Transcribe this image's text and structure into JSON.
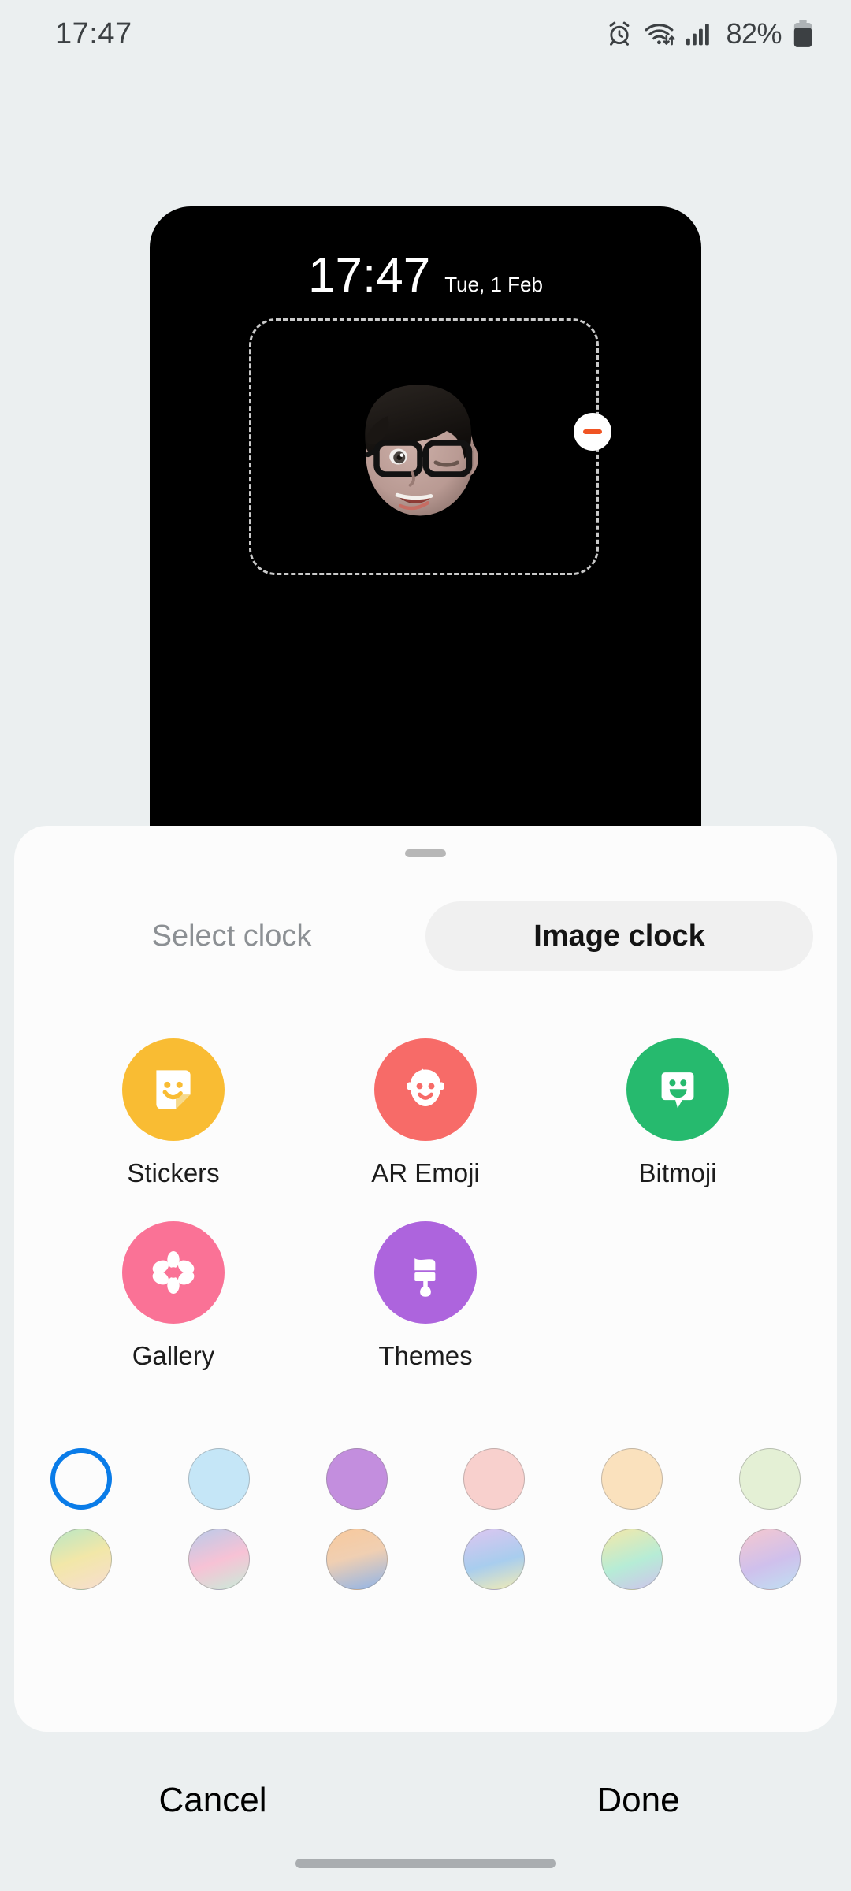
{
  "status_bar": {
    "clock": "17:47",
    "battery_percent": "82%",
    "icons": [
      "alarm-icon",
      "wifi-icon",
      "signal-icon",
      "battery-icon"
    ]
  },
  "preview": {
    "time": "17:47",
    "date": "Tue, 1 Feb",
    "remove_badge": "remove-icon",
    "avatar": "ar-emoji-avatar"
  },
  "sheet": {
    "tabs": [
      {
        "label": "Select clock",
        "active": false
      },
      {
        "label": "Image clock",
        "active": true
      }
    ],
    "apps": [
      {
        "label": "Stickers",
        "icon": "stickers-icon",
        "color": "#f9bc33"
      },
      {
        "label": "AR Emoji",
        "icon": "ar-emoji-icon",
        "color": "#f76b68"
      },
      {
        "label": "Bitmoji",
        "icon": "bitmoji-icon",
        "color": "#26ba6e"
      },
      {
        "label": "Gallery",
        "icon": "gallery-icon",
        "color": "#fa7296"
      },
      {
        "label": "Themes",
        "icon": "themes-icon",
        "color": "#ad64dd"
      }
    ],
    "swatch_rows": [
      [
        {
          "name": "white",
          "fill": "#fcfcfc",
          "selected": true
        },
        {
          "name": "light-blue",
          "fill": "#c5e6f7",
          "selected": false
        },
        {
          "name": "orchid",
          "fill": "#c38ede",
          "selected": false
        },
        {
          "name": "light-pink",
          "fill": "#f8d0cd",
          "selected": false
        },
        {
          "name": "peach",
          "fill": "#fae1bd",
          "selected": false
        },
        {
          "name": "light-green",
          "fill": "#e4f0d5",
          "selected": false
        }
      ],
      [
        {
          "name": "green-yellow-peach",
          "fill": "linear-gradient(160deg,#b9e7c4 0%,#f2e7a8 48%,#f7ddd0 100%)",
          "selected": false
        },
        {
          "name": "blue-pink-mint",
          "fill": "linear-gradient(160deg,#b9cbea 0%,#f7c2d5 52%,#c8ecd9 100%)",
          "selected": false
        },
        {
          "name": "orange-blue",
          "fill": "linear-gradient(165deg,#f8c99c 0%,#f0cfb2 45%,#8fb4e8 100%)",
          "selected": false
        },
        {
          "name": "purple-yellow",
          "fill": "linear-gradient(165deg,#ddc6f0 0%,#a8cdee 55%,#f3ecb4 100%)",
          "selected": false
        },
        {
          "name": "yellow-mint-violet",
          "fill": "linear-gradient(160deg,#f5e8a8 0%,#b6ecd6 55%,#cfc3ec 100%)",
          "selected": false
        },
        {
          "name": "pink-violet-blue",
          "fill": "linear-gradient(160deg,#f6c8cf 0%,#cfc0ec 55%,#bfe0f2 100%)",
          "selected": false
        }
      ]
    ]
  },
  "actions": {
    "cancel_label": "Cancel",
    "done_label": "Done"
  },
  "nav_bar": {
    "pill": "gesture-pill"
  }
}
